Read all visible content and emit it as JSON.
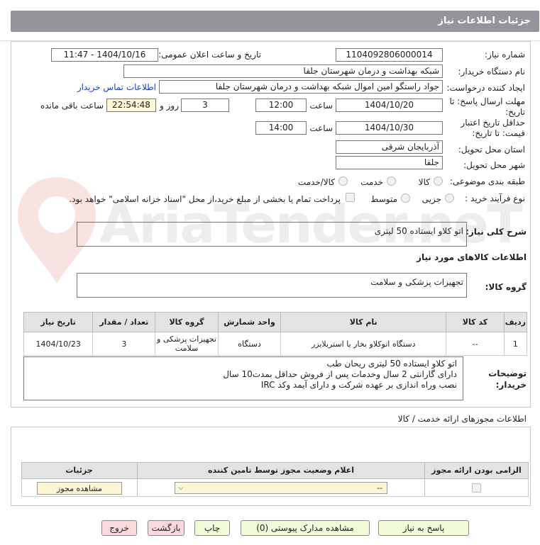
{
  "header": {
    "title": "جزئیات اطلاعات نیاز"
  },
  "fields": {
    "need_number_label": "شماره نیاز:",
    "need_number": "1104092806000014",
    "announce_label": "تاریخ و ساعت اعلان عمومی:",
    "announce_value": "1404/10/16 - 11:47",
    "buyer_org_label": "نام دستگاه خریدار:",
    "buyer_org": "شبکه بهداشت و درمان شهرستان جلفا",
    "requester_label": "ایجاد کننده درخواست:",
    "requester": "جواد راستگو امین اموال شبکه بهداشت و درمان شهرستان جلفا",
    "contact_link": "اطلاعات تماس خریدار",
    "reply_deadline_label": "مهلت ارسال پاسخ: تا تاریخ:",
    "reply_date": "1404/10/20",
    "time_label": "ساعت",
    "reply_time": "12:00",
    "days_value": "3",
    "days_label": "روز و",
    "remaining_time": "22:54:48",
    "remaining_label": "ساعت باقی مانده",
    "validity_label": "حداقل تاریخ اعتبار قیمت: تا تاریخ:",
    "validity_date": "1404/10/30",
    "validity_time": "14:00",
    "province_label": "استان محل تحویل:",
    "province": "آذربایجان شرقی",
    "city_label": "شهر محل تحویل:",
    "city": "جلفا",
    "category_label": "طبقه بندی موضوعی:",
    "category_options": [
      "کالا",
      "خدمت",
      "کالا/خدمت"
    ],
    "process_label": "نوع فرآیند خرید :",
    "process_options": [
      "جزیی",
      "متوسط"
    ],
    "payment_note": "پرداخت تمام یا بخشی از مبلغ خرید،از محل \"اسناد خزانه اسلامی\" خواهد بود."
  },
  "description": {
    "label": "شرح کلی نیاز:",
    "value": "اتو کلاو ایستاده  50 لیتری"
  },
  "goods_section": {
    "title": "اطلاعات کالاهای مورد نیاز",
    "group_label": "گروه کالا:",
    "group_value": "تجهیزات پزشکی و سلامت"
  },
  "goods_table": {
    "headers": [
      "ردیف",
      "کد کالا",
      "نام کالا",
      "واحد شمارش",
      "گروه کالا",
      "تعداد / مقدار",
      "تاریخ نیاز"
    ],
    "rows": [
      [
        "1",
        "--",
        "دستگاه اتوکلاو بخار یا استریلایزر",
        "دستگاه",
        "تجهیزات پزشکی و سلامت",
        "3",
        "1404/10/23"
      ]
    ]
  },
  "buyer_notes": {
    "label": "توضیحات خریدار:",
    "lines": [
      "اتو کلاو ایستاده  50 لیتری ریحان طب",
      "دارای گارانتی 2 سال وخدمات پس از فروش حداقل بمدت10 سال",
      "نصب وراه اندازی بر عهده شرکت و دارای آیمد وکد  IRC"
    ]
  },
  "permits_section": {
    "title": "اطلاعات مجوزهای ارائه خدمت / کالا",
    "headers": [
      "الزامی بودن ارائه مجوز",
      "اعلام وضعیت مجوز توسط تامین کننده",
      "جزئیات"
    ],
    "select_value": "--",
    "view_button": "مشاهده مجوز"
  },
  "buttons": {
    "reply": "پاسخ به نیاز",
    "attachments": "مشاهده مدارک پیوستی (0)",
    "print": "چاپ",
    "back": "بازگشت",
    "exit": "خروج"
  },
  "colors": {
    "header_bg": "#94959b",
    "yellow_field": "#fbf6d6",
    "green_button": "#f1fad9",
    "pink_button": "#fad9dc",
    "link": "#1a3fc2"
  },
  "watermark": {
    "text": "AriaTender.neT"
  }
}
